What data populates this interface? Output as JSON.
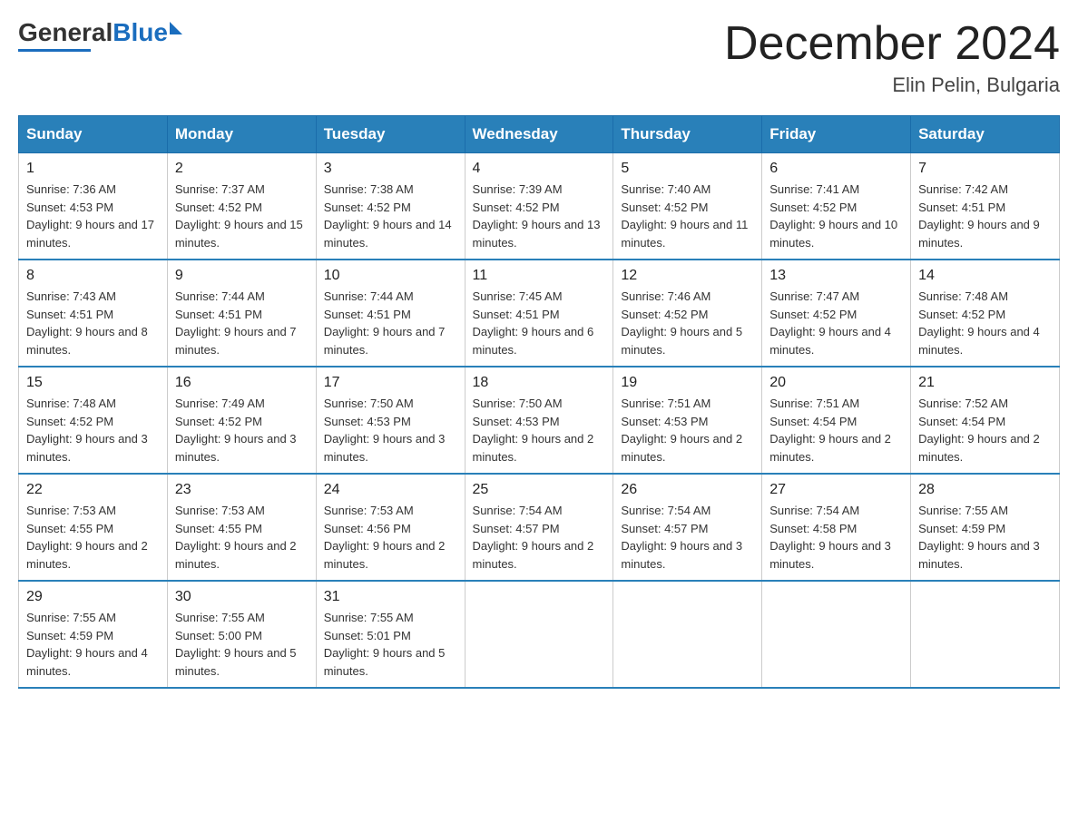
{
  "header": {
    "logo_general": "General",
    "logo_blue": "Blue",
    "month_title": "December 2024",
    "location": "Elin Pelin, Bulgaria"
  },
  "days_of_week": [
    "Sunday",
    "Monday",
    "Tuesday",
    "Wednesday",
    "Thursday",
    "Friday",
    "Saturday"
  ],
  "weeks": [
    [
      {
        "day": "1",
        "sunrise": "7:36 AM",
        "sunset": "4:53 PM",
        "daylight": "9 hours and 17 minutes."
      },
      {
        "day": "2",
        "sunrise": "7:37 AM",
        "sunset": "4:52 PM",
        "daylight": "9 hours and 15 minutes."
      },
      {
        "day": "3",
        "sunrise": "7:38 AM",
        "sunset": "4:52 PM",
        "daylight": "9 hours and 14 minutes."
      },
      {
        "day": "4",
        "sunrise": "7:39 AM",
        "sunset": "4:52 PM",
        "daylight": "9 hours and 13 minutes."
      },
      {
        "day": "5",
        "sunrise": "7:40 AM",
        "sunset": "4:52 PM",
        "daylight": "9 hours and 11 minutes."
      },
      {
        "day": "6",
        "sunrise": "7:41 AM",
        "sunset": "4:52 PM",
        "daylight": "9 hours and 10 minutes."
      },
      {
        "day": "7",
        "sunrise": "7:42 AM",
        "sunset": "4:51 PM",
        "daylight": "9 hours and 9 minutes."
      }
    ],
    [
      {
        "day": "8",
        "sunrise": "7:43 AM",
        "sunset": "4:51 PM",
        "daylight": "9 hours and 8 minutes."
      },
      {
        "day": "9",
        "sunrise": "7:44 AM",
        "sunset": "4:51 PM",
        "daylight": "9 hours and 7 minutes."
      },
      {
        "day": "10",
        "sunrise": "7:44 AM",
        "sunset": "4:51 PM",
        "daylight": "9 hours and 7 minutes."
      },
      {
        "day": "11",
        "sunrise": "7:45 AM",
        "sunset": "4:51 PM",
        "daylight": "9 hours and 6 minutes."
      },
      {
        "day": "12",
        "sunrise": "7:46 AM",
        "sunset": "4:52 PM",
        "daylight": "9 hours and 5 minutes."
      },
      {
        "day": "13",
        "sunrise": "7:47 AM",
        "sunset": "4:52 PM",
        "daylight": "9 hours and 4 minutes."
      },
      {
        "day": "14",
        "sunrise": "7:48 AM",
        "sunset": "4:52 PM",
        "daylight": "9 hours and 4 minutes."
      }
    ],
    [
      {
        "day": "15",
        "sunrise": "7:48 AM",
        "sunset": "4:52 PM",
        "daylight": "9 hours and 3 minutes."
      },
      {
        "day": "16",
        "sunrise": "7:49 AM",
        "sunset": "4:52 PM",
        "daylight": "9 hours and 3 minutes."
      },
      {
        "day": "17",
        "sunrise": "7:50 AM",
        "sunset": "4:53 PM",
        "daylight": "9 hours and 3 minutes."
      },
      {
        "day": "18",
        "sunrise": "7:50 AM",
        "sunset": "4:53 PM",
        "daylight": "9 hours and 2 minutes."
      },
      {
        "day": "19",
        "sunrise": "7:51 AM",
        "sunset": "4:53 PM",
        "daylight": "9 hours and 2 minutes."
      },
      {
        "day": "20",
        "sunrise": "7:51 AM",
        "sunset": "4:54 PM",
        "daylight": "9 hours and 2 minutes."
      },
      {
        "day": "21",
        "sunrise": "7:52 AM",
        "sunset": "4:54 PM",
        "daylight": "9 hours and 2 minutes."
      }
    ],
    [
      {
        "day": "22",
        "sunrise": "7:53 AM",
        "sunset": "4:55 PM",
        "daylight": "9 hours and 2 minutes."
      },
      {
        "day": "23",
        "sunrise": "7:53 AM",
        "sunset": "4:55 PM",
        "daylight": "9 hours and 2 minutes."
      },
      {
        "day": "24",
        "sunrise": "7:53 AM",
        "sunset": "4:56 PM",
        "daylight": "9 hours and 2 minutes."
      },
      {
        "day": "25",
        "sunrise": "7:54 AM",
        "sunset": "4:57 PM",
        "daylight": "9 hours and 2 minutes."
      },
      {
        "day": "26",
        "sunrise": "7:54 AM",
        "sunset": "4:57 PM",
        "daylight": "9 hours and 3 minutes."
      },
      {
        "day": "27",
        "sunrise": "7:54 AM",
        "sunset": "4:58 PM",
        "daylight": "9 hours and 3 minutes."
      },
      {
        "day": "28",
        "sunrise": "7:55 AM",
        "sunset": "4:59 PM",
        "daylight": "9 hours and 3 minutes."
      }
    ],
    [
      {
        "day": "29",
        "sunrise": "7:55 AM",
        "sunset": "4:59 PM",
        "daylight": "9 hours and 4 minutes."
      },
      {
        "day": "30",
        "sunrise": "7:55 AM",
        "sunset": "5:00 PM",
        "daylight": "9 hours and 5 minutes."
      },
      {
        "day": "31",
        "sunrise": "7:55 AM",
        "sunset": "5:01 PM",
        "daylight": "9 hours and 5 minutes."
      },
      null,
      null,
      null,
      null
    ]
  ]
}
